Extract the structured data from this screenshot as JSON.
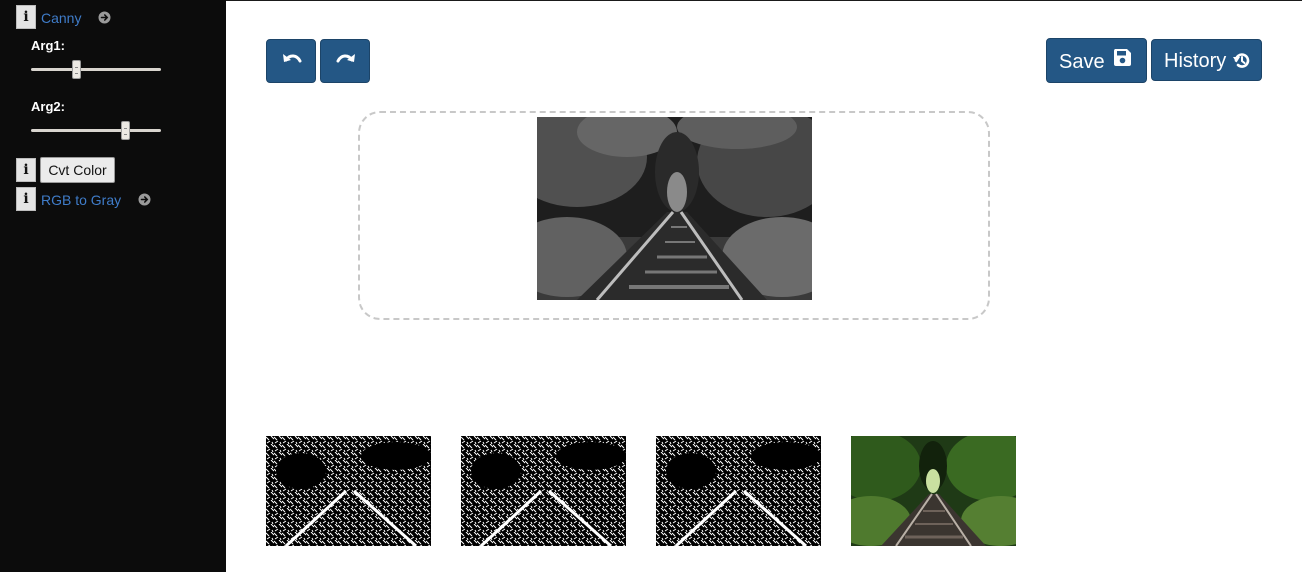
{
  "sidebar": {
    "ops": [
      {
        "info": "i",
        "label": "Canny",
        "args": [
          {
            "label": "Arg1:",
            "value_fraction": 0.35
          },
          {
            "label": "Arg2:",
            "value_fraction": 0.73
          }
        ]
      },
      {
        "info": "i",
        "button_label": "Cvt Color",
        "label": "RGB to Gray"
      }
    ]
  },
  "toolbar": {
    "undo_icon": "undo-icon",
    "redo_icon": "redo-icon",
    "save_label": "Save",
    "save_icon": "floppy-disk-icon",
    "history_label": "History",
    "history_icon": "history-icon"
  },
  "colors": {
    "sidebar_bg": "#0c0c0c",
    "button_primary": "#245785",
    "link": "#3f7cc9",
    "dropzone_border": "#c8c8c8"
  },
  "preview": {
    "kind": "grayscale railway photo"
  },
  "thumbnails": [
    {
      "kind": "canny edge map"
    },
    {
      "kind": "canny edge map"
    },
    {
      "kind": "canny edge map"
    },
    {
      "kind": "original color photo"
    }
  ]
}
